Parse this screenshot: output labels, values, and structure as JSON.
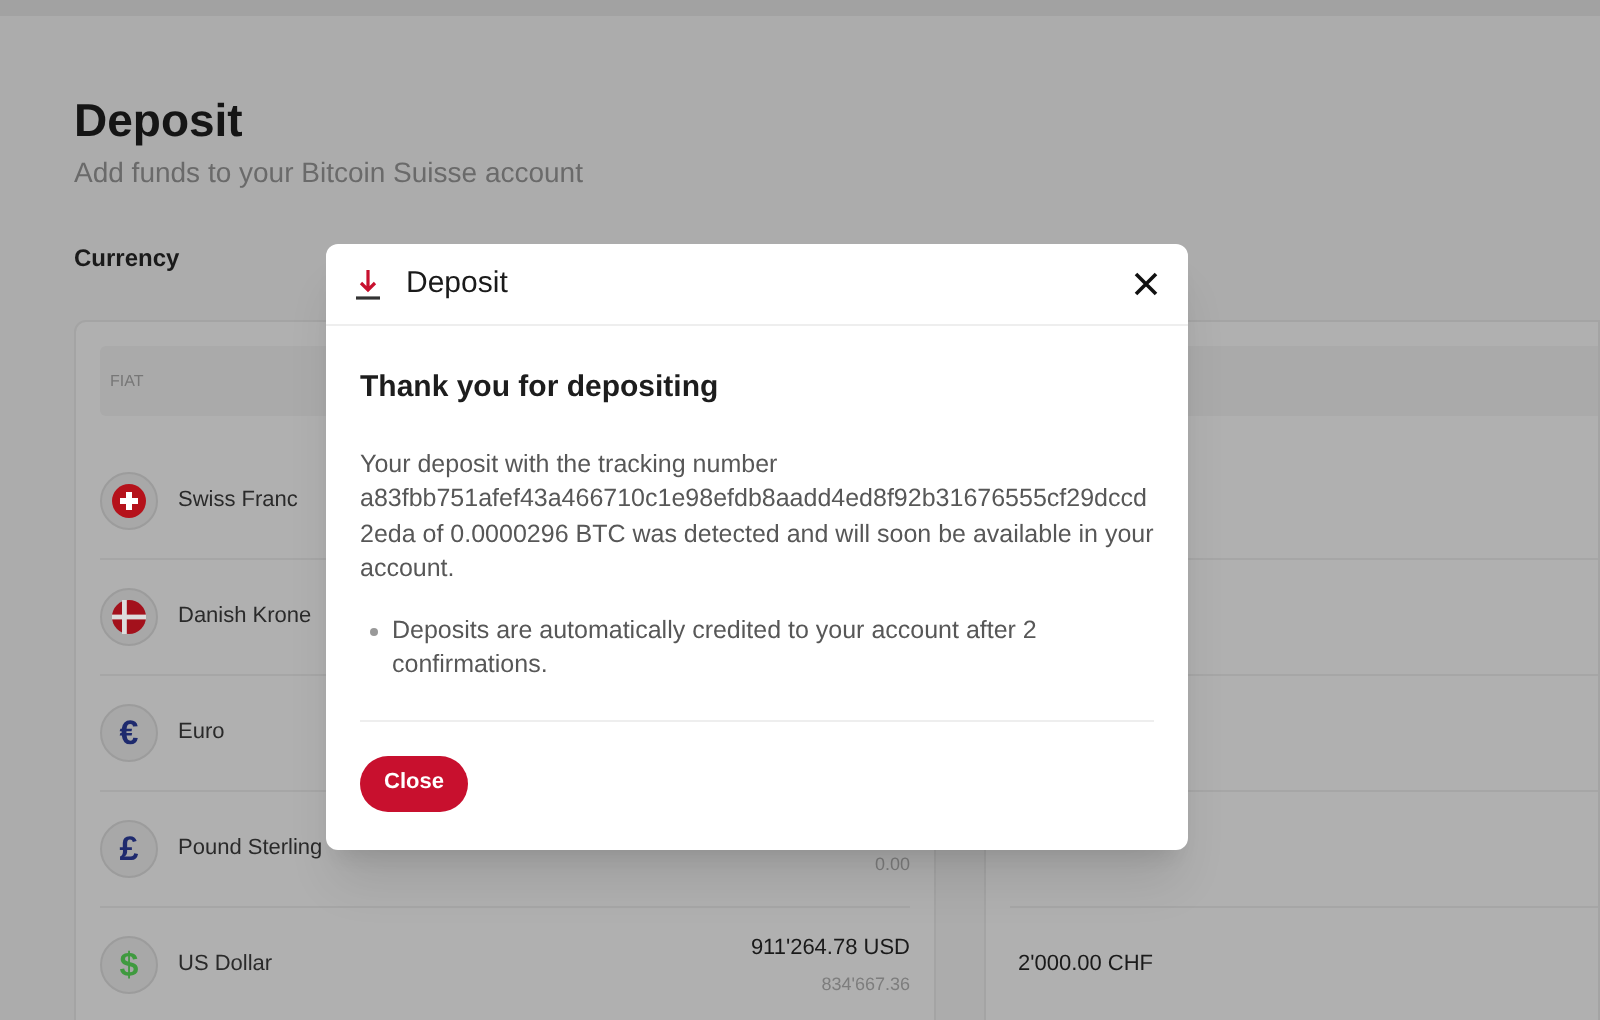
{
  "page": {
    "title": "Deposit",
    "subtitle": "Add funds to your Bitcoin Suisse account",
    "currency_label": "Currency"
  },
  "fiat_card": {
    "header": "FIAT",
    "rows": [
      {
        "name": "Swiss Franc",
        "icon": {
          "kind": "swiss"
        }
      },
      {
        "name": "Danish Krone",
        "icon": {
          "kind": "danish"
        }
      },
      {
        "name": "Euro",
        "icon": {
          "kind": "glyph",
          "glyph": "€",
          "color": "#1e2a6e"
        }
      },
      {
        "name": "Pound Sterling",
        "icon": {
          "kind": "glyph",
          "glyph": "£",
          "color": "#1e2a6e"
        },
        "secondary": "0.00"
      },
      {
        "name": "US Dollar",
        "icon": {
          "kind": "glyph",
          "glyph": "$",
          "color": "#3f9a3f"
        },
        "amount": "911'264.78 USD",
        "secondary": "834'667.36"
      }
    ]
  },
  "side_card": {
    "amount": "2'000.00 CHF"
  },
  "dialog": {
    "title": "Deposit",
    "heading": "Thank you for depositing",
    "message": "Your deposit with the tracking number a83fbb751afef43a466710c1e98efdb8aadd4ed8f92b31676555cf29dccd2eda of 0.0000296 BTC was detected and will soon be available in your account.",
    "notes": [
      "Deposits are automatically credited to your account after 2 confirmations."
    ],
    "close_button": "Close"
  }
}
